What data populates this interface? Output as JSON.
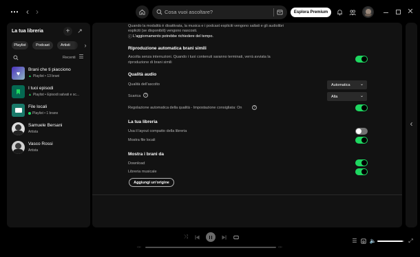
{
  "topbar": {
    "menu_icon": "more-dots-icon",
    "search_placeholder": "Cosa vuoi ascoltare?",
    "explore_label": "Esplora Premium"
  },
  "sidebar": {
    "title": "La tua libreria",
    "chips": [
      "Playlist",
      "Podcast",
      "Artisti"
    ],
    "sort_label": "Recenti",
    "items": [
      {
        "name": "Brani che ti piacciono",
        "sub": "Playlist • 13 brani",
        "pinned": true
      },
      {
        "name": "I tuoi episodi",
        "sub": "Playlist • Episodi salvati e sc...",
        "pinned": true
      },
      {
        "name": "File locali",
        "sub": "Playlist • 1 brano",
        "pinned": false
      },
      {
        "name": "Samuele Bersani",
        "sub": "Artista",
        "pinned": false
      },
      {
        "name": "Vasco Rossi",
        "sub": "Artista",
        "pinned": false
      }
    ]
  },
  "settings": {
    "explicit_line1": "Quando la modalità è disattivata, la musica e i podcast espliciti vengono saltati e gli audiolibri",
    "explicit_line2": "espliciti (se disponibili) vengono nascosti.",
    "explicit_note": "L'aggiornamento potrebbe richiedere del tempo.",
    "autoplay": {
      "title": "Riproduzione automatica brani simili",
      "desc1": "Ascolta senza interruzioni. Quando i tuoi contenuti saranno terminati, verrà avviata la",
      "desc2": "riproduzione di brani simili",
      "enabled": true
    },
    "audio": {
      "title": "Qualità audio",
      "streaming_label": "Qualità dell'ascolto",
      "streaming_value": "Automatica",
      "download_label": "Scarica",
      "download_value": "Alta",
      "auto_adjust_label": "Regolazione automatica della qualità - Impostazione consigliata: On",
      "auto_adjust_enabled": true
    },
    "library": {
      "title": "La tua libreria",
      "compact_label": "Usa il layout compatto della libreria",
      "compact_enabled": false,
      "local_files_label": "Mostra file locali",
      "local_files_enabled": true
    },
    "show_songs": {
      "title": "Mostra i brani da",
      "download_label": "Download",
      "download_enabled": true,
      "music_library_label": "Libreria musicale",
      "music_library_enabled": true,
      "add_source_label": "Aggiungi un'origine"
    }
  },
  "player": {
    "time_elapsed": "-:--",
    "time_total": "-:--",
    "volume_level": 0.95
  },
  "colors": {
    "accent": "#1ed760",
    "background": "#000000",
    "panel": "#121212"
  }
}
